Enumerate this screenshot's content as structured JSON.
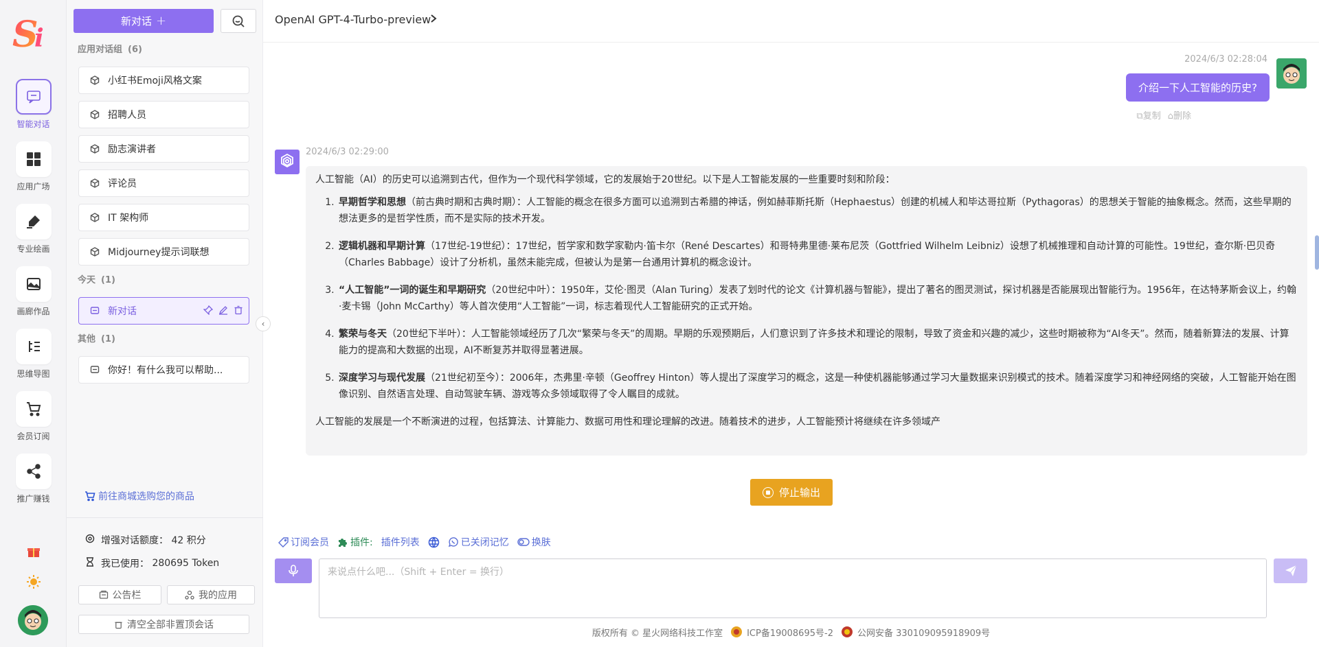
{
  "rail": {
    "items": [
      {
        "label": "智能对话",
        "icon": "chat-icon",
        "active": true
      },
      {
        "label": "应用广场",
        "icon": "grid-icon",
        "active": false
      },
      {
        "label": "专业绘画",
        "icon": "paint-icon",
        "active": false
      },
      {
        "label": "画廊作品",
        "icon": "gallery-icon",
        "active": false
      },
      {
        "label": "思维导图",
        "icon": "mindmap-icon",
        "active": false
      },
      {
        "label": "会员订阅",
        "icon": "cart-icon",
        "active": false
      },
      {
        "label": "推广赚钱",
        "icon": "share-icon",
        "active": false
      }
    ],
    "gift_icon": "gift-icon",
    "theme_icon": "sun-icon"
  },
  "sidebar": {
    "new_chat_label": "新对话",
    "app_group": {
      "title": "应用对话组",
      "count": "(6)"
    },
    "app_items": [
      "小红书Emoji风格文案",
      "招聘人员",
      "励志演讲者",
      "评论员",
      "IT 架构师",
      "Midjourney提示词联想"
    ],
    "today_group": {
      "title": "今天",
      "count": "(1)"
    },
    "today_items": [
      "新对话"
    ],
    "other_group": {
      "title": "其他",
      "count": "(1)"
    },
    "other_items": [
      "你好！有什么我可以帮助..."
    ],
    "shop_link": "前往商城选购您的商品",
    "quota_label": "增强对话额度：",
    "quota_value": "42 积分",
    "used_label": "我已使用：",
    "used_value": "280695 Token",
    "notice_btn": "公告栏",
    "myapps_btn": "我的应用",
    "clear_btn": "清空全部非置顶会话"
  },
  "main": {
    "model_name": "OpenAI GPT-4-Turbo-preview",
    "user_message": {
      "timestamp": "2024/6/3 02:28:04",
      "text": "介绍一下人工智能的历史?",
      "copy_label": "复制",
      "delete_label": "删除"
    },
    "ai_message": {
      "timestamp": "2024/6/3 02:29:00",
      "intro": "人工智能（AI）的历史可以追溯到古代，但作为一个现代科学领域，它的发展始于20世纪。以下是人工智能发展的一些重要时刻和阶段：",
      "items": [
        {
          "title": "早期哲学和思想",
          "text": "（前古典时期和古典时期）：人工智能的概念在很多方面可以追溯到古希腊的神话，例如赫菲斯托斯（Hephaestus）创建的机械人和毕达哥拉斯（Pythagoras）的思想关于智能的抽象概念。然而，这些早期的想法更多的是哲学性质，而不是实际的技术开发。"
        },
        {
          "title": "逻辑机器和早期计算",
          "text": "（17世纪-19世纪）：17世纪，哲学家和数学家勒内·笛卡尔（René Descartes）和哥特弗里德·莱布尼茨（Gottfried Wilhelm Leibniz）设想了机械推理和自动计算的可能性。19世纪，查尔斯·巴贝奇（Charles Babbage）设计了分析机，虽然未能完成，但被认为是第一台通用计算机的概念设计。"
        },
        {
          "title": "“人工智能”一词的诞生和早期研究",
          "text": "（20世纪中叶）：1950年，艾伦·图灵（Alan Turing）发表了划时代的论文《计算机器与智能》，提出了著名的图灵测试，探讨机器是否能展现出智能行为。1956年，在达特茅斯会议上，约翰·麦卡锡（John McCarthy）等人首次使用“人工智能”一词，标志着现代人工智能研究的正式开始。"
        },
        {
          "title": "繁荣与冬天",
          "text": "（20世纪下半叶）：人工智能领域经历了几次“繁荣与冬天”的周期。早期的乐观预期后，人们意识到了许多技术和理论的限制，导致了资金和兴趣的减少，这些时期被称为“AI冬天”。然而，随着新算法的发展、计算能力的提高和大数据的出现，AI不断复苏并取得显著进展。"
        },
        {
          "title": "深度学习与现代发展",
          "text": "（21世纪初至今）：2006年，杰弗里·辛顿（Geoffrey Hinton）等人提出了深度学习的概念，这是一种使机器能够通过学习大量数据来识别模式的技术。随着深度学习和神经网络的突破，人工智能开始在图像识别、自然语言处理、自动驾驶车辆、游戏等众多领域取得了令人瞩目的成就。"
        }
      ],
      "outro": "人工智能的发展是一个不断演进的过程，包括算法、计算能力、数据可用性和理论理解的改进。随着技术的进步，人工智能预计将继续在许多领域产"
    },
    "stop_label": "停止输出",
    "toolbar": {
      "subscribe": "订阅会员",
      "plugin_label": "插件:",
      "plugin_list": "插件列表",
      "memory": "已关闭记忆",
      "skin": "换肤"
    },
    "input_placeholder": "来说点什么吧...（Shift + Enter = 换行）",
    "footer": {
      "copyright": "版权所有 © 星火网络科技工作室",
      "icp": "ICP备19008695号-2",
      "police": "公网安备 33010909591890​9号"
    }
  }
}
